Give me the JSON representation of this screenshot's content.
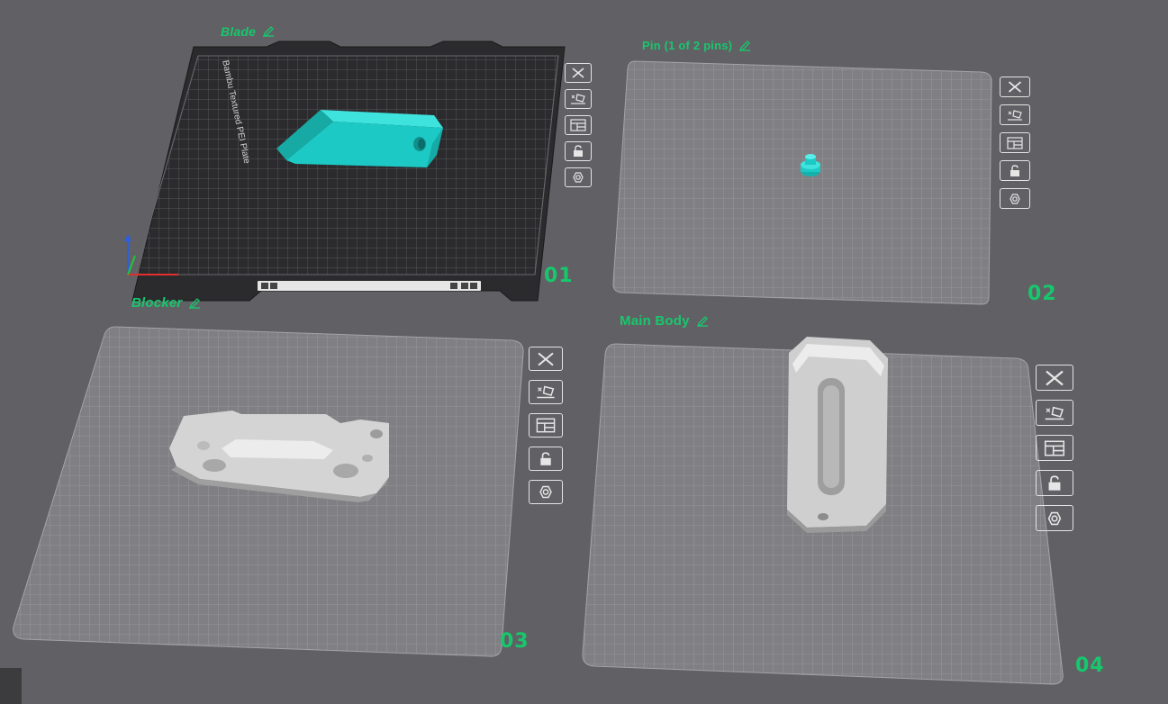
{
  "plates": [
    {
      "id": "plate-1",
      "name": "Blade",
      "number": "01",
      "selected": true,
      "plate_type": "Bambu Textured PEI Plate"
    },
    {
      "id": "plate-2",
      "name": "Pin (1 of 2 pins)",
      "number": "02",
      "selected": false
    },
    {
      "id": "plate-3",
      "name": "Blocker",
      "number": "03",
      "selected": false
    },
    {
      "id": "plate-4",
      "name": "Main Body",
      "number": "04",
      "selected": false
    }
  ],
  "plate_toolbar_icons": [
    "close-icon",
    "auto-orient-icon",
    "arrange-icon",
    "lock-icon",
    "settings-icon"
  ],
  "colors": {
    "background": "#616165",
    "plate_dark": "#2b2b2e",
    "plate_light": "#7d7d80",
    "grid_line": "#9a9a9e",
    "label_green": "#17c76c",
    "selected_model": "#1cc9c4",
    "model_grey": "#c9c9c9"
  }
}
